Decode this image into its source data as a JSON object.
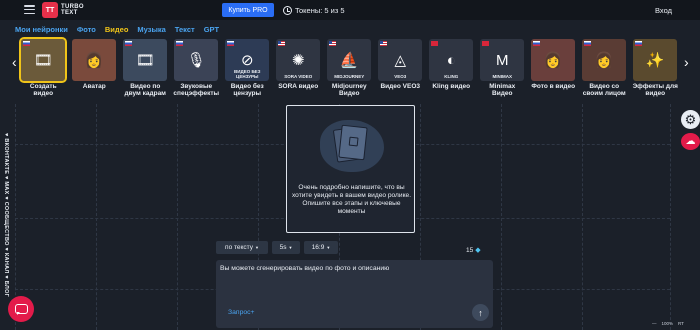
{
  "header": {
    "logo_mark": "TT",
    "logo_line1": "TURBO",
    "logo_line2": "TEXT",
    "pro_button": "Купить PRO",
    "tokens": "Токены: 5 из 5",
    "login": "Вход"
  },
  "tabs": [
    {
      "label": "Мои нейронки"
    },
    {
      "label": "Фото"
    },
    {
      "label": "Видео",
      "active": true
    },
    {
      "label": "Музыка"
    },
    {
      "label": "Текст"
    },
    {
      "label": "GPT"
    }
  ],
  "cards": [
    {
      "label": "Создать видео",
      "flag": "ru",
      "glyph": "🎞",
      "thumb_title": "",
      "bg": "#6b5a3a",
      "active": true
    },
    {
      "label": "Аватар",
      "flag": "",
      "glyph": "👩",
      "thumb_title": "",
      "bg": "#7a4a3c"
    },
    {
      "label": "Видео по двум кадрам",
      "flag": "ru",
      "glyph": "🎞",
      "thumb_title": "",
      "bg": "#3c4a5e"
    },
    {
      "label": "Звуковые спецэффекты",
      "flag": "ru",
      "glyph": "🎙",
      "thumb_title": "",
      "bg": "#3b4356"
    },
    {
      "label": "Видео без цензуры",
      "flag": "ru",
      "glyph": "⊘",
      "thumb_title": "ВИДЕО БЕЗ ЦЕНЗУРЫ",
      "bg": "#2d3b55"
    },
    {
      "label": "SORA видео",
      "flag": "us",
      "glyph": "✺",
      "thumb_title": "SORA VIDEO",
      "bg": "#2f3542"
    },
    {
      "label": "Midjourney Видео",
      "flag": "us",
      "glyph": "⛵",
      "thumb_title": "MIDJOURNEY",
      "bg": "#2f3542"
    },
    {
      "label": "Видео VEO3",
      "flag": "us",
      "glyph": "◬",
      "thumb_title": "VEO3",
      "bg": "#2f3542"
    },
    {
      "label": "Kling видео",
      "flag": "cn",
      "glyph": "◐",
      "thumb_title": "KLING",
      "bg": "#2f3542"
    },
    {
      "label": "Minimax Видео",
      "flag": "cn",
      "glyph": "M",
      "thumb_title": "MINIMAX",
      "bg": "#2f3542"
    },
    {
      "label": "Фото в видео",
      "flag": "ru",
      "glyph": "👩",
      "thumb_title": "",
      "bg": "#6a3f3c"
    },
    {
      "label": "Видео со своим лицом",
      "flag": "ru",
      "glyph": "👩",
      "thumb_title": "",
      "bg": "#5a3c34"
    },
    {
      "label": "Эффекты для видео",
      "flag": "ru",
      "glyph": "✨",
      "thumb_title": "",
      "bg": "#5a4a2e"
    }
  ],
  "side_links": "♥ ВКОНТАКТЕ  ♥ MAX  ♥ СООБЩЕСТВО  ♥ КАНАЛ  ♥ БЛОГ",
  "dropzone": {
    "text": "Очень подробно напишите, что вы хотите увидеть в вашем видео ролике. Опишите все этапы и ключевые моменты"
  },
  "controls": {
    "mode": "по тексту",
    "duration": "5s",
    "ratio": "16:9"
  },
  "cost": "15",
  "prompt": {
    "placeholder": "Вы можете сгенерировать видео по фото и описанию",
    "request_link": "Запрос+"
  },
  "zoom": {
    "left": "—",
    "value": "100%",
    "right": "RT"
  },
  "colors": {
    "accent_blue": "#2a6df4",
    "active_tab": "#f0c419",
    "brand_red": "#e8304a",
    "link_blue": "#4aa3ef"
  }
}
